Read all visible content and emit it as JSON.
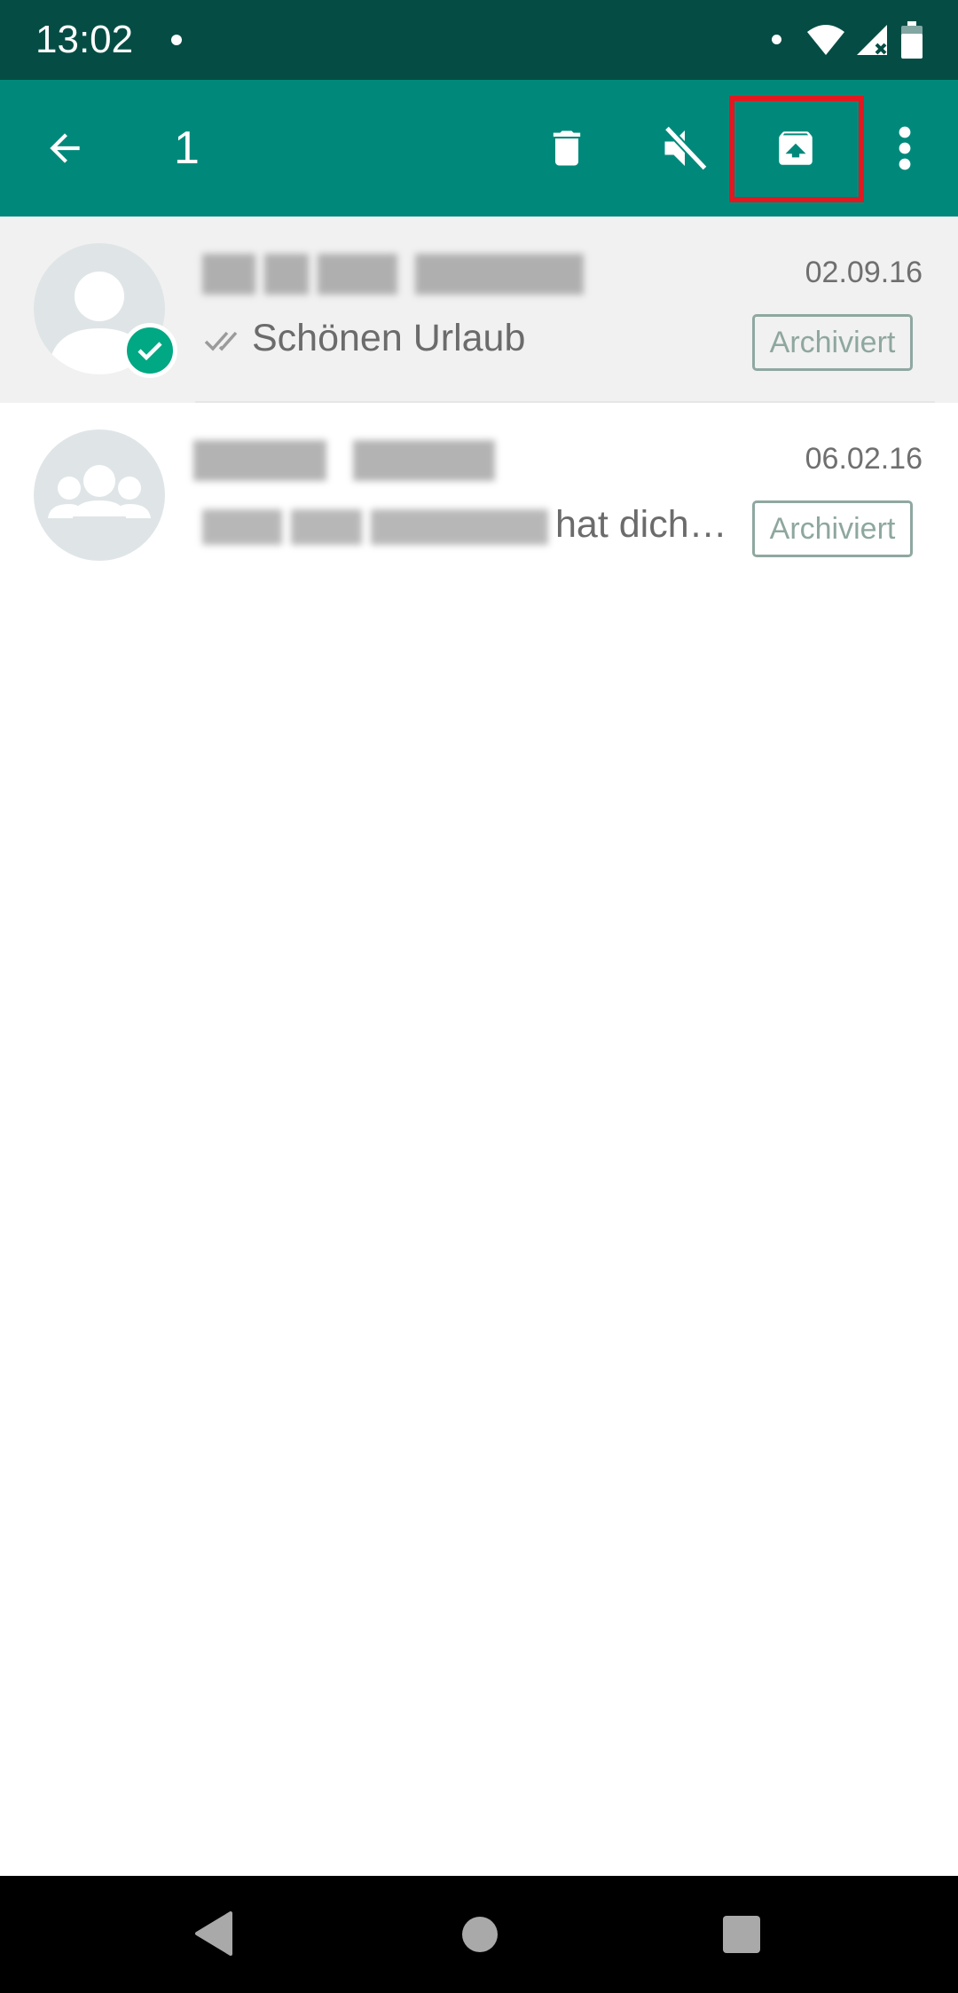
{
  "status_bar": {
    "time": "13:02"
  },
  "app_bar": {
    "selected_count": "1",
    "icons": [
      "back-arrow-icon",
      "delete-icon",
      "mute-icon",
      "unarchive-icon",
      "more-vertical-icon"
    ],
    "highlight_color": "#e3171f",
    "background_color": "#00897b"
  },
  "chats": [
    {
      "date": "02.09.16",
      "preview": "Schönen Urlaub",
      "badge": "Archiviert",
      "selected": true,
      "avatar": "person-icon",
      "status": "double-check-icon"
    },
    {
      "date": "06.02.16",
      "preview": "hat dich…",
      "badge": "Archiviert",
      "selected": false,
      "avatar": "group-icon"
    }
  ],
  "nav_bar": {
    "icons": [
      "back-triangle-icon",
      "home-circle-icon",
      "recents-square-icon"
    ]
  }
}
